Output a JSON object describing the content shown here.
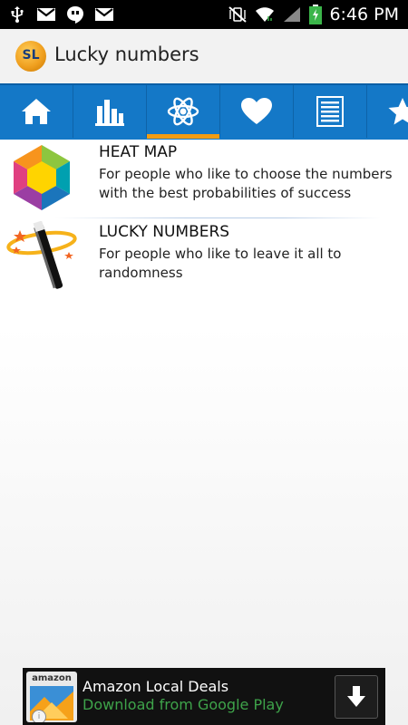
{
  "status_bar": {
    "time": "6:46 PM",
    "icons_left": [
      "usb-icon",
      "gmail-icon",
      "hangouts-icon",
      "gmail-icon"
    ],
    "icons_right": [
      "vibrate-mute-icon",
      "wifi-icon",
      "signal-icon",
      "battery-icon"
    ]
  },
  "action_bar": {
    "logo_text": "SL",
    "title": "Lucky numbers"
  },
  "tabs": [
    {
      "icon": "home-icon"
    },
    {
      "icon": "bar-chart-icon"
    },
    {
      "icon": "atom-icon",
      "selected": true
    },
    {
      "icon": "heart-icon"
    },
    {
      "icon": "document-icon"
    },
    {
      "icon": "star-icon"
    }
  ],
  "list": [
    {
      "icon": "heat-map-hexagon-icon",
      "title": "HEAT MAP",
      "description": "For people who like to choose the numbers with the best probabilities of success"
    },
    {
      "icon": "magic-wand-icon",
      "title": "LUCKY NUMBERS",
      "description": "For people who like to leave it all to randomness"
    }
  ],
  "ad": {
    "logo_text": "amazon",
    "title": "Amazon Local Deals",
    "subtitle": "Download from Google Play",
    "info": "i"
  },
  "colors": {
    "tab_bar": "#1478c7",
    "tab_indicator": "#f39c12",
    "ad_subtitle": "#3ea34a"
  }
}
